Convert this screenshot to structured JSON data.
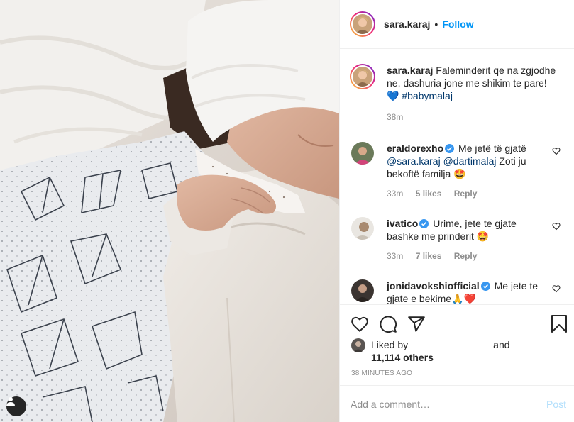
{
  "header": {
    "username": "sara.karaj",
    "separator": "•",
    "follow_label": "Follow"
  },
  "caption": {
    "username": "sara.karaj",
    "text": "Faleminderit qe na zgjodhe ne, dashuria jone me shikim te pare!",
    "emoji": "💙",
    "hashtag": "#babymalaj",
    "time": "38m"
  },
  "comments": [
    {
      "username": "eraldorexho",
      "verified": true,
      "text_before": "Me jetë të gjatë",
      "mention1": "@sara.karaj",
      "mention2": "@dartimalaj",
      "text_after": "Zoti ju bekoftë familja",
      "emoji": "🤩",
      "time": "33m",
      "likes": "5 likes",
      "reply": "Reply"
    },
    {
      "username": "ivatico",
      "verified": true,
      "text": "Urime, jete te gjate bashke me prinderit",
      "emoji": "🤩",
      "time": "33m",
      "likes": "7 likes",
      "reply": "Reply"
    },
    {
      "username": "jonidavokshiofficial",
      "verified": true,
      "text": "Me jete te gjate e bekime",
      "emoji": "🙏❤️"
    }
  ],
  "likes": {
    "prefix": "Liked by",
    "connector": "and",
    "count": "11,114 others"
  },
  "timestamp": "38 MINUTES AGO",
  "add_comment": {
    "placeholder": "Add a comment…",
    "post_label": "Post"
  },
  "colors": {
    "link_blue": "#0095f6",
    "mention_blue": "#00376b",
    "verified_blue": "#3897f0",
    "muted_text": "#8e8e8e",
    "post_disabled": "#b2dffc"
  },
  "icons": [
    "user-tag-icon",
    "heart-icon",
    "comment-icon",
    "share-icon",
    "bookmark-icon",
    "verified-icon",
    "small-heart-icon"
  ]
}
